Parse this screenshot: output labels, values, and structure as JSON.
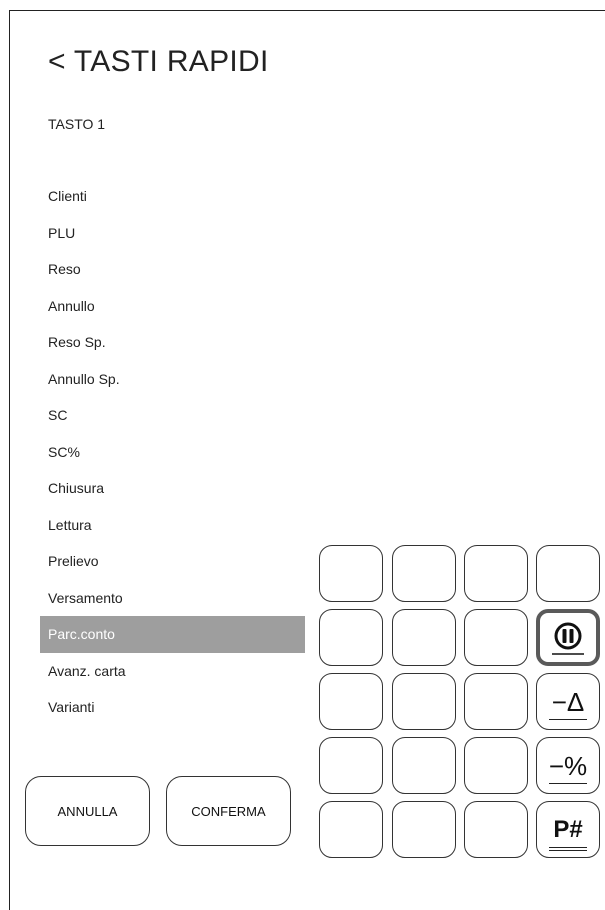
{
  "header": {
    "title": "< TASTI RAPIDI",
    "subtitle": "TASTO 1"
  },
  "menu": {
    "items": [
      {
        "label": "Clienti"
      },
      {
        "label": "PLU"
      },
      {
        "label": "Reso"
      },
      {
        "label": "Annullo"
      },
      {
        "label": "Reso Sp."
      },
      {
        "label": "Annullo Sp."
      },
      {
        "label": "SC"
      },
      {
        "label": "SC%"
      },
      {
        "label": "Chiusura"
      },
      {
        "label": "Lettura"
      },
      {
        "label": "Prelievo"
      },
      {
        "label": "Versamento"
      },
      {
        "label": "Parc.conto",
        "selected": true
      },
      {
        "label": "Avanz. carta"
      },
      {
        "label": "Varianti"
      }
    ]
  },
  "buttons": {
    "cancel": "ANNULLA",
    "confirm": "CONFERMA"
  },
  "keypad": {
    "rows": 5,
    "cols": 4,
    "function_keys": {
      "pause": {
        "icon": "pause-circle-icon",
        "selected": true
      },
      "minus_delta": {
        "icon": "minus-delta-icon",
        "text": "−Δ"
      },
      "minus_percent": {
        "icon": "minus-percent-icon",
        "text": "−%"
      },
      "p_hash": {
        "icon": "p-hash-icon",
        "text": "P#"
      }
    }
  },
  "colors": {
    "selected_bg": "#9e9e9e",
    "selected_key_border": "#5a5a5a",
    "line": "#333333"
  }
}
